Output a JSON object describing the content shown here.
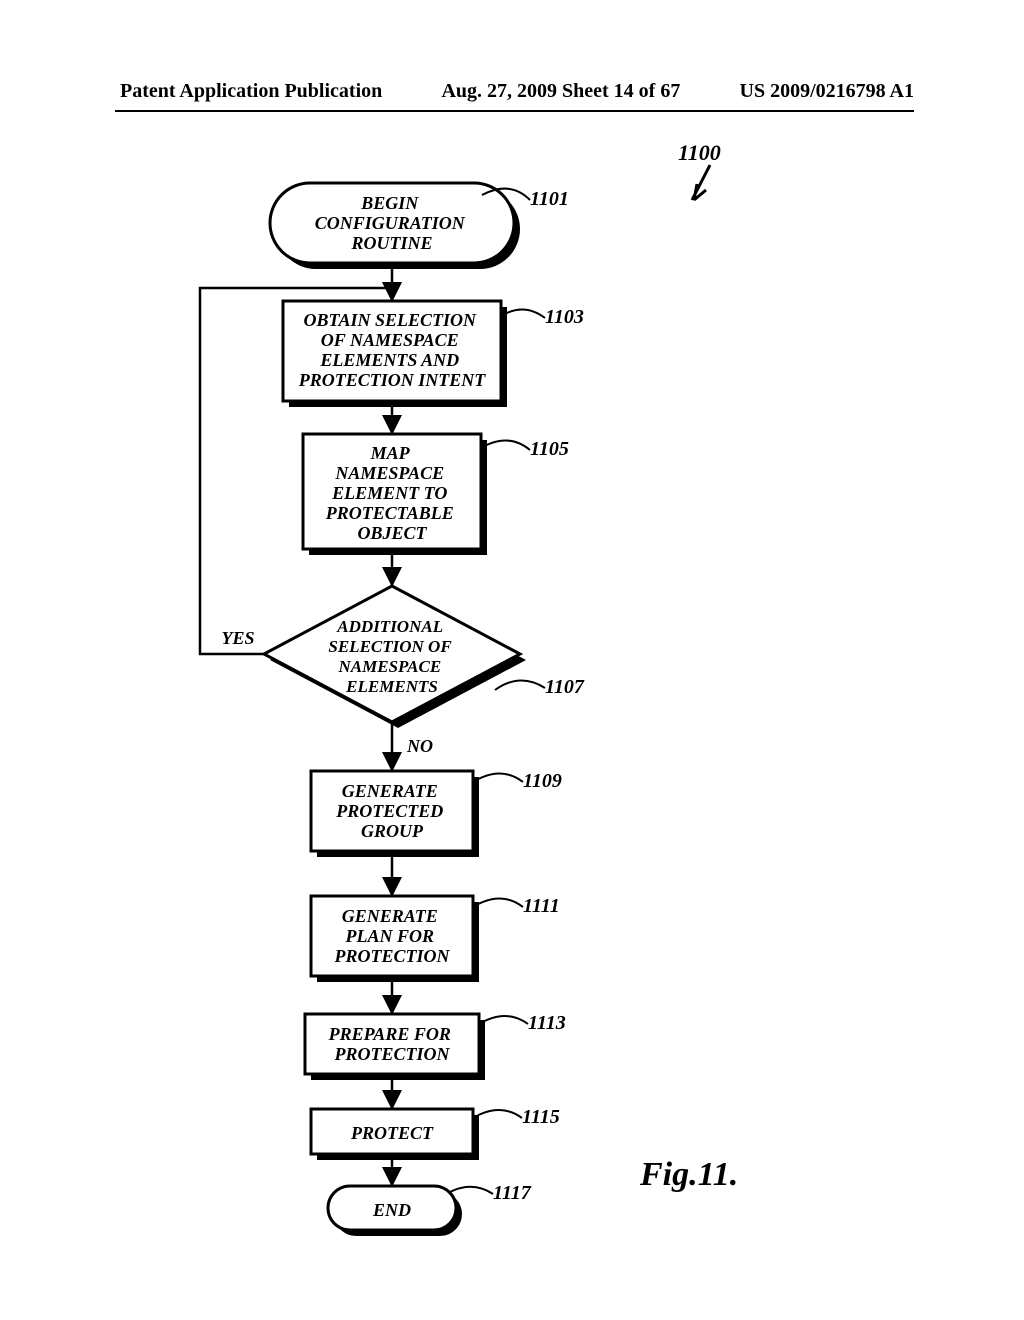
{
  "header": {
    "left": "Patent Application Publication",
    "center": "Aug. 27, 2009  Sheet 14 of 67",
    "right": "US 2009/0216798 A1"
  },
  "figure_ref": "1100",
  "figure_label": "Fig.11.",
  "blocks": {
    "b1101": {
      "ref": "1101",
      "lines": [
        "BEGIN",
        "CONFIGURATION",
        "ROUTINE"
      ]
    },
    "b1103": {
      "ref": "1103",
      "lines": [
        "OBTAIN SELECTION",
        "OF NAMESPACE",
        "ELEMENTS AND",
        "PROTECTION INTENT"
      ]
    },
    "b1105": {
      "ref": "1105",
      "lines": [
        "MAP",
        "NAMESPACE",
        "ELEMENT TO",
        "PROTECTABLE",
        "OBJECT"
      ]
    },
    "b1107": {
      "ref": "1107",
      "lines": [
        "ADDITIONAL",
        "SELECTION OF",
        "NAMESPACE",
        "ELEMENTS"
      ]
    },
    "b1109": {
      "ref": "1109",
      "lines": [
        "GENERATE",
        "PROTECTED",
        "GROUP"
      ]
    },
    "b1111": {
      "ref": "1111",
      "lines": [
        "GENERATE",
        "PLAN FOR",
        "PROTECTION"
      ]
    },
    "b1113": {
      "ref": "1113",
      "lines": [
        "PREPARE FOR",
        "PROTECTION"
      ]
    },
    "b1115": {
      "ref": "1115",
      "lines": [
        "PROTECT"
      ]
    },
    "b1117": {
      "ref": "1117",
      "lines": [
        "END"
      ]
    }
  },
  "branches": {
    "yes": "YES",
    "no": "NO"
  }
}
